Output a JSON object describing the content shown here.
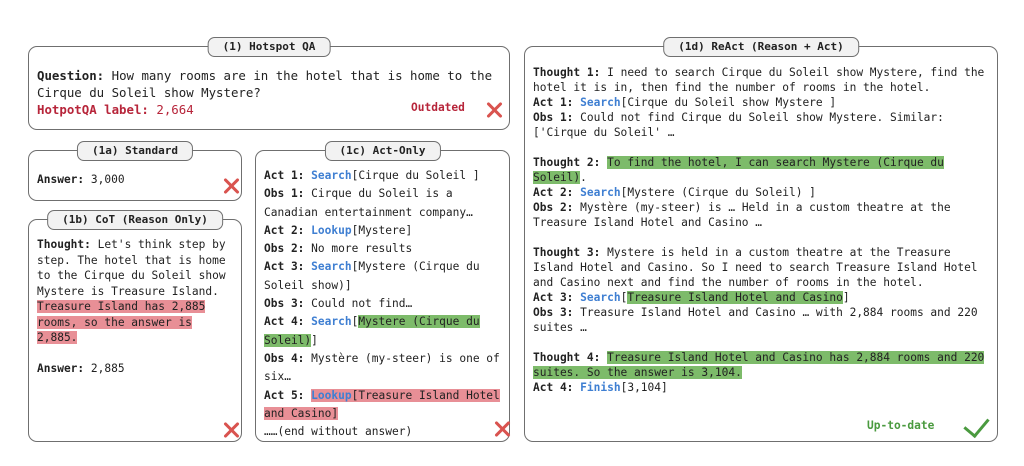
{
  "hotspot": {
    "title": "(1) Hotspot QA",
    "question_key": "Question:",
    "question": "How many rooms are in the hotel that is home to the Cirque du Soleil show Mystere?",
    "label_key": "HotpotQA label:",
    "label_value": "2,664",
    "status": "Outdated"
  },
  "standard": {
    "title": "(1a) Standard",
    "answer_key": "Answer:",
    "answer": "3,000"
  },
  "cot": {
    "title": "(1b) CoT (Reason Only)",
    "thought_key": "Thought:",
    "thought_plain": "Let's think step by step. The hotel that is home to the Cirque du Soleil show Mystere is Treasure Island.",
    "thought_hl": "Treasure Island has 2,885 rooms, so the answer is 2,885.",
    "answer_key": "Answer:",
    "answer": "2,885"
  },
  "actonly": {
    "title": "(1c) Act-Only",
    "act1_key": "Act 1:",
    "act1_verb": "Search",
    "act1_arg": "[Cirque du Soleil ]",
    "obs1_key": "Obs 1:",
    "obs1": "Cirque du Soleil is a Canadian entertainment company…",
    "act2_key": "Act 2:",
    "act2_verb": "Lookup",
    "act2_arg": "[Mystere]",
    "obs2_key": "Obs 2:",
    "obs2": "No more results",
    "act3_key": "Act 3:",
    "act3_verb": "Search",
    "act3_arg": "[Mystere (Cirque du Soleil show)]",
    "obs3_key": "Obs 3:",
    "obs3": "Could not find…",
    "act4_key": "Act 4:",
    "act4_verb": "Search",
    "act4_lb": "[",
    "act4_hl": "Mystere (Cirque du Soleil)",
    "act4_rb": "]",
    "obs4_key": "Obs 4:",
    "obs4": "Mystère (my-steer)  is one of six…",
    "act5_key": "Act 5:",
    "act5_verb": "Lookup",
    "act5_hl": "[Treasure Island Hotel and Casino]",
    "end": "……(end without answer)"
  },
  "react": {
    "title": "(1d) ReAct (Reason + Act)",
    "t1_key": "Thought 1:",
    "t1": "I need to search Cirque du Soleil show Mystere, find the hotel it is in, then find the number of rooms in the hotel.",
    "a1_key": "Act 1:",
    "a1_verb": "Search",
    "a1_arg": "[Cirque du Soleil show Mystere ]",
    "o1_key": "Obs 1:",
    "o1": "Could not find Cirque du Soleil show Mystere. Similar: ['Cirque du Soleil' …",
    "t2_key": "Thought 2:",
    "t2_hl": "To find the hotel, I can search Mystere (Cirque du Soleil)",
    "t2_end": ".",
    "a2_key": "Act 2:",
    "a2_verb": "Search",
    "a2_arg": "[Mystere (Cirque du Soleil) ]",
    "o2_key": "Obs 2:",
    "o2": "Mystère (my-steer)  is  …  Held in a custom theatre  at the Treasure Island Hotel and Casino …",
    "t3_key": "Thought 3:",
    "t3": "Mystere is held in a custom theatre at the Treasure Island Hotel and Casino. So I need to search Treasure Island Hotel and Casino next and find the number of rooms in the hotel.",
    "a3_key": "Act 3:",
    "a3_verb": "Search",
    "a3_lb": "[",
    "a3_hl": "Treasure Island Hotel and Casino",
    "a3_rb": "]",
    "o3_key": "Obs 3:",
    "o3": "Treasure  Island Hotel and Casino …  with 2,884 rooms and 220 suites …",
    "t4_key": "Thought 4:",
    "t4_hl": "Treasure Island Hotel and Casino has 2,884 rooms and 220 suites. So the answer is 3,104.",
    "a4_key": "Act 4:",
    "a4_verb": "Finish",
    "a4_arg": "[3,104]",
    "status": "Up-to-date"
  },
  "colors": {
    "highlight_green": "#7dbb6a",
    "highlight_red": "#e88f96",
    "action_blue": "#3f7fd2",
    "wrong_red": "#d9534f",
    "correct_green": "#4a9a3f"
  },
  "icons": [
    "cross-icon",
    "check-icon"
  ]
}
